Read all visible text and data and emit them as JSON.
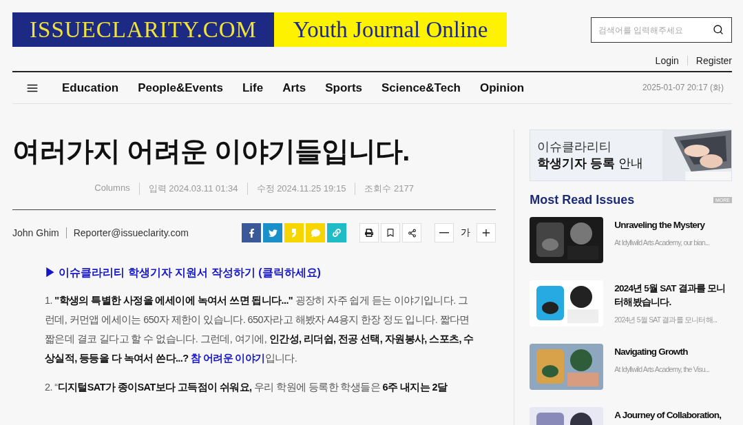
{
  "header": {
    "logo_left": "ISSUECLARITY.COM",
    "logo_right": "Youth Journal Online",
    "search": {
      "placeholder": "검색어를 입력해주세요"
    },
    "account_links": [
      "Login",
      "Register"
    ]
  },
  "nav": {
    "items": [
      "Education",
      "People&Events",
      "Life",
      "Arts",
      "Sports",
      "Science&Tech",
      "Opinion"
    ],
    "date": "2025-01-07 20:17 (화)"
  },
  "article": {
    "title": "여러가지 어려운 이야기들입니다.",
    "meta": [
      "Columns",
      "입력 2024.03.11 01:34",
      "수정 2024.11.25 19:15",
      "조회수 2177"
    ],
    "author": "John Ghim",
    "email": "Reporter@issueclarity.com",
    "share_buttons": [
      {
        "kind": "facebook",
        "color": "#3b5998"
      },
      {
        "kind": "twitter",
        "color": "#1b8fc7"
      },
      {
        "kind": "story",
        "color": "#f7d600"
      },
      {
        "kind": "talk",
        "color": "#f7d600"
      },
      {
        "kind": "link",
        "color": "#1fbcc6"
      }
    ],
    "tools": [
      {
        "kind": "print"
      },
      {
        "kind": "bookmark"
      },
      {
        "kind": "share"
      }
    ],
    "font_size": {
      "label": "가"
    },
    "apply_link": "▶ 이슈클라리티 학생기자 지원서 작성하기 (클릭하세요)",
    "paragraphs": [
      [
        {
          "kind": "plain",
          "text": "1. "
        },
        {
          "kind": "bold",
          "text": "\"학생의 특별한 사정을 에세이에 녹여서 쓰면 됩니다...\""
        },
        {
          "kind": "plain",
          "text": " 굉장히 자주 쉽게 듣는 이야기입니다. 그런데, 커먼앱 에세이는 650자 제한이 있습니다. 650자라고 해봤자 A4용지 한장 정도 입니다. 짧다면 짧은데 결코 길다고 할 수 없습니다. 그런데, 여기에, "
        },
        {
          "kind": "bold",
          "text": "인간성, 리더쉽, 전공 선택, 자원봉사, 스포츠, 수상실적, 등등을 다 녹여서 쓴다...? "
        },
        {
          "kind": "highlight",
          "text": "참 어려운 이야기"
        },
        {
          "kind": "plain",
          "text": "입니다."
        }
      ],
      [
        {
          "kind": "plain",
          "text": "2. “"
        },
        {
          "kind": "bold",
          "text": "디지털SAT가 종이SAT보다 고득점이 쉬워요,"
        },
        {
          "kind": "plain",
          "text": " 우리 학원에 등록한 학생들은 "
        },
        {
          "kind": "bold",
          "text": "6주 내지는 2달"
        }
      ]
    ]
  },
  "sidebar": {
    "banner": {
      "line1": "이슈클라리티",
      "line2_bold": "학생기자 등록",
      "line2_rest": "안내"
    },
    "section_title": "Most Read Issues",
    "more": "MORE",
    "items": [
      {
        "title": "Unraveling the Mystery",
        "summary": "At Idyllwild Arts Academy, our bian..."
      },
      {
        "title": "2024년 5월 SAT 결과를 모니터해봤습니다.",
        "summary": "2024년 5월 SAT 결과를 모니터해..."
      },
      {
        "title": "Navigating Growth",
        "summary": "At Idyllwild Arts Academy, the Visu..."
      },
      {
        "title": "A Journey of Collaboration,"
      }
    ]
  }
}
